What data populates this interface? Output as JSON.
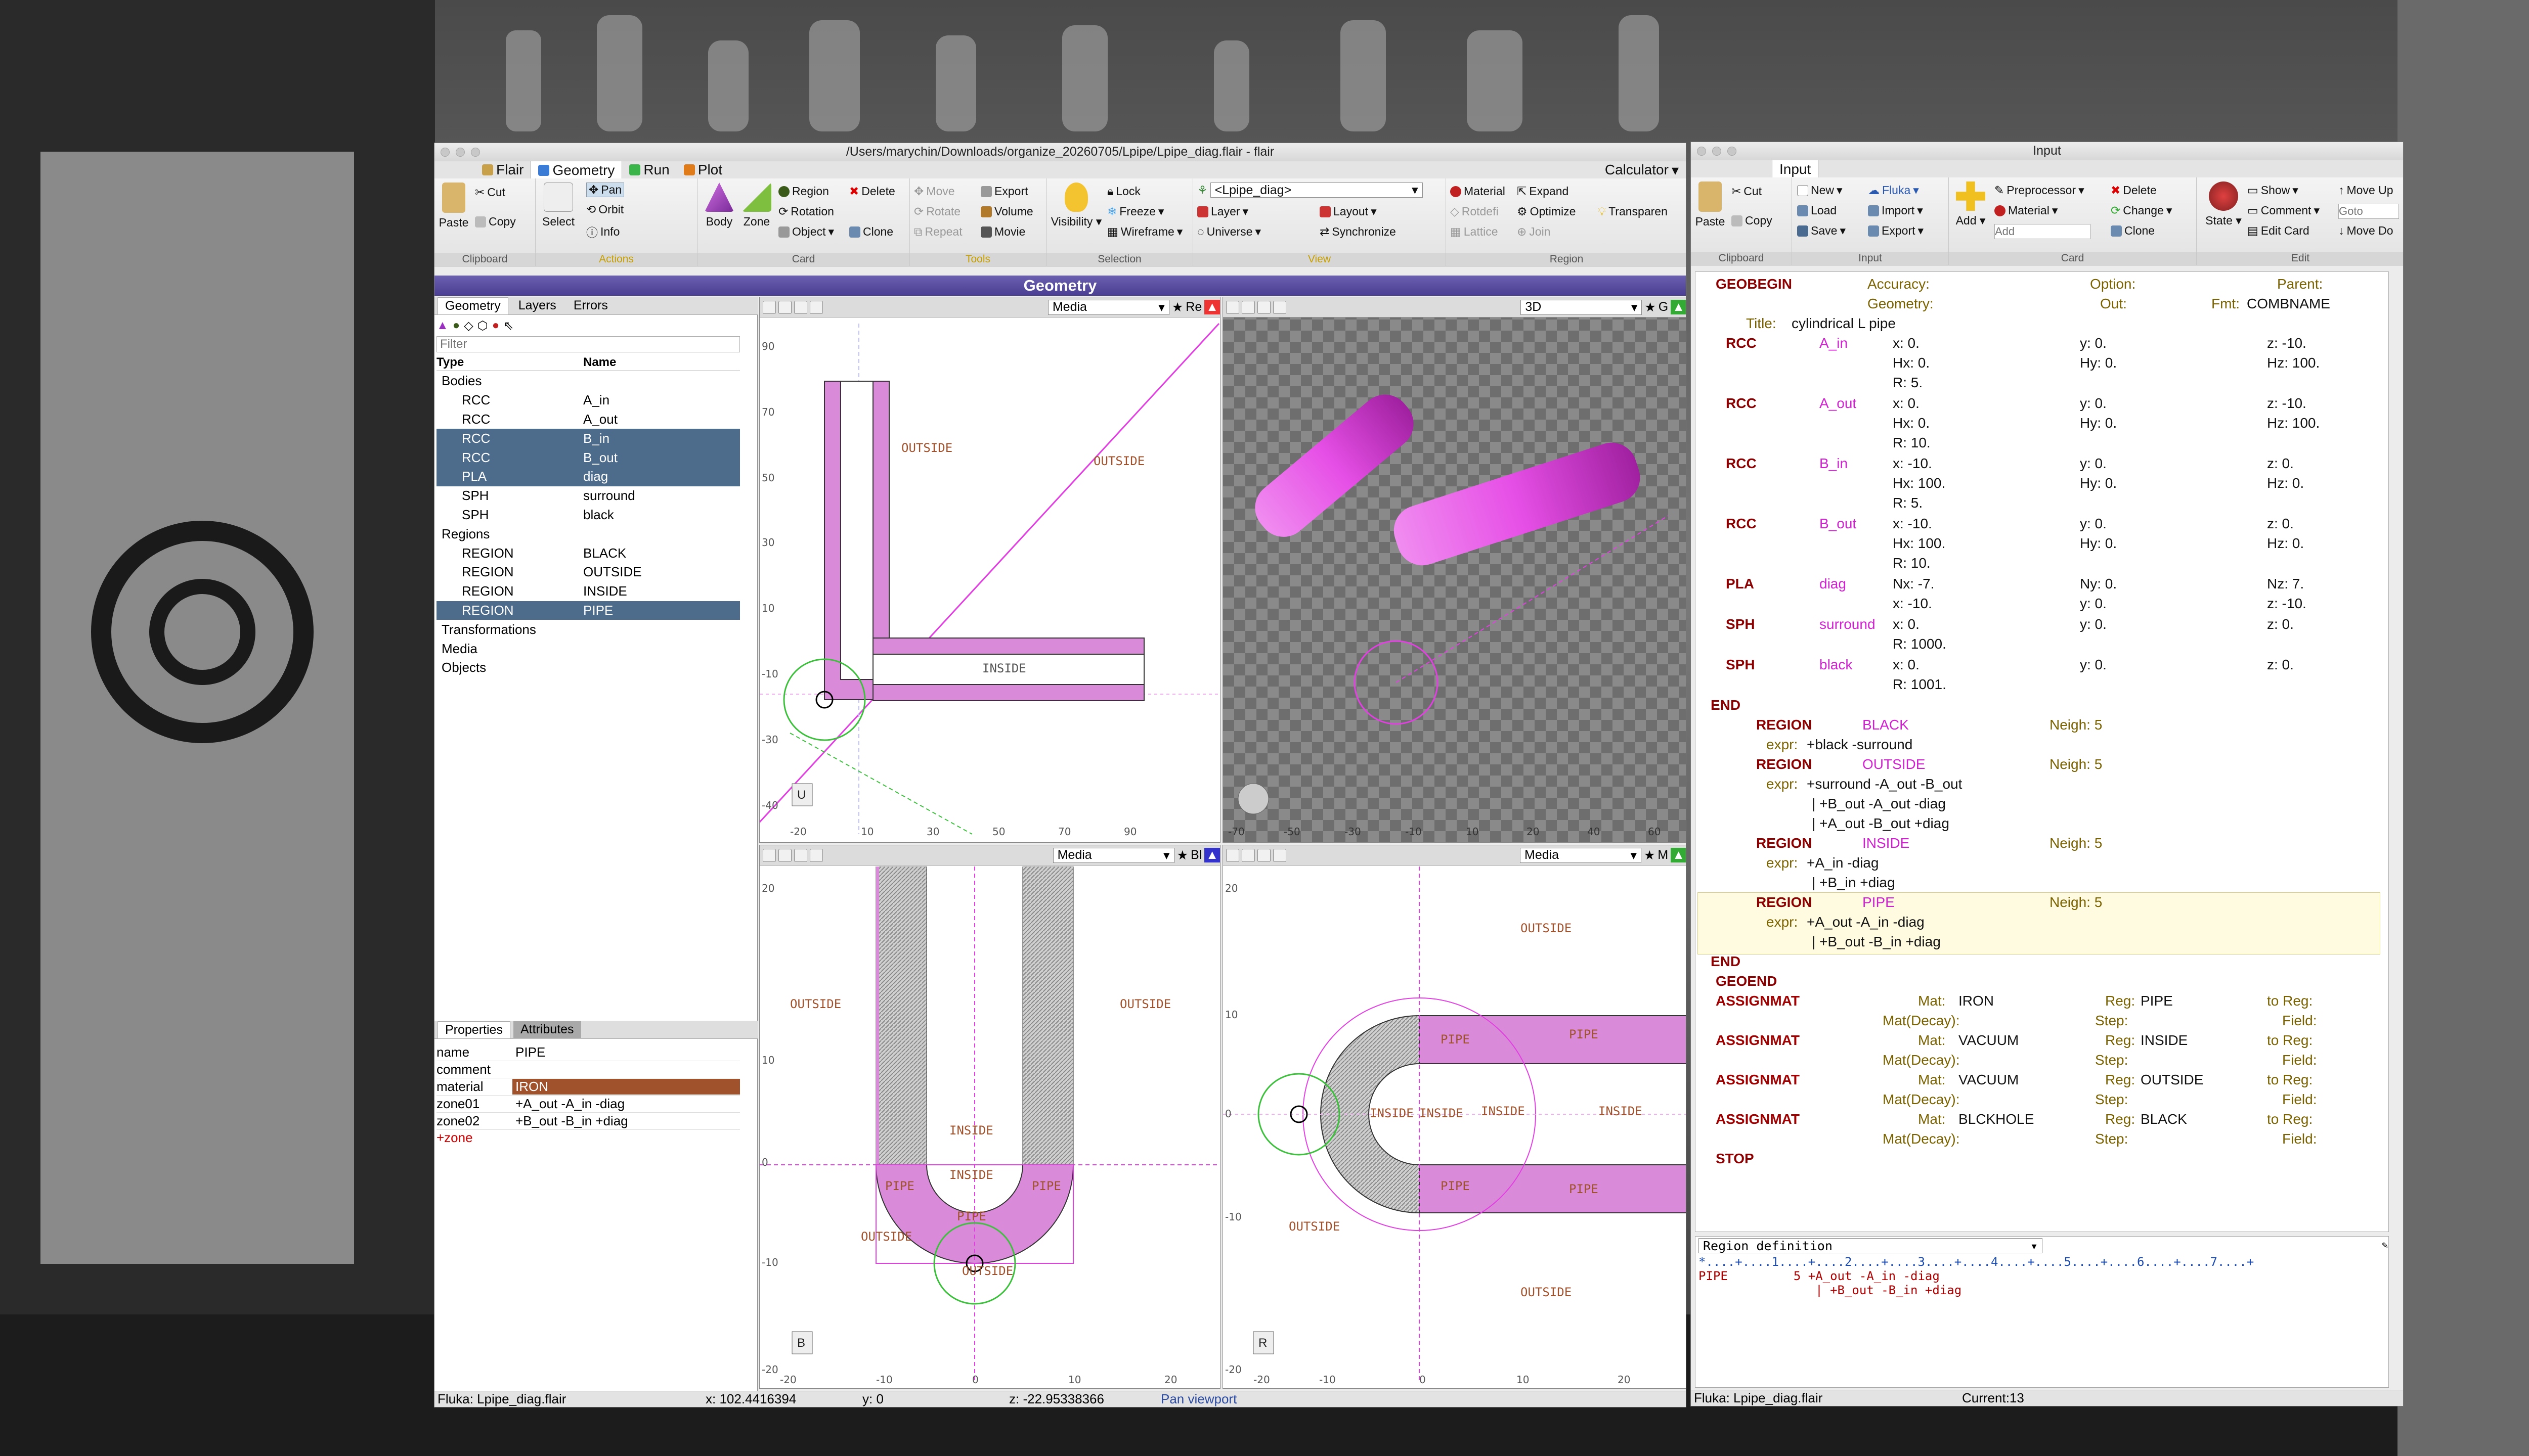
{
  "main_window": {
    "title": "/Users/marychin/Downloads/organize_20260705/Lpipe/Lpipe_diag.flair - flair",
    "tabs": [
      "Flair",
      "Geometry",
      "Run",
      "Plot"
    ],
    "calculator_label": "Calculator",
    "ribbon": {
      "clipboard": {
        "label": "Clipboard",
        "paste": "Paste",
        "cut": "Cut",
        "copy": "Copy"
      },
      "actions": {
        "label": "Actions",
        "select": "Select",
        "pan": "Pan",
        "orbit": "Orbit",
        "info": "Info"
      },
      "card": {
        "label": "Card",
        "body": "Body",
        "zone": "Zone",
        "region": "Region",
        "rotation": "Rotation",
        "object": "Object",
        "delete": "Delete",
        "clone": "Clone"
      },
      "tools": {
        "label": "Tools",
        "move": "Move",
        "rotate": "Rotate",
        "repeat": "Repeat",
        "export": "Export",
        "volume": "Volume",
        "movie": "Movie",
        "visibility": "Visibility"
      },
      "selection": {
        "label": "Selection",
        "lock": "Lock",
        "freeze": "Freeze",
        "wireframe": "Wireframe"
      },
      "view": {
        "label": "View",
        "combo": "<Lpipe_diag>",
        "layer": "Layer",
        "layout": "Layout",
        "universe": "Universe",
        "synchronize": "Synchronize"
      },
      "region": {
        "label": "Region",
        "material": "Material",
        "expand": "Expand",
        "rotdefi": "Rotdefi",
        "optimize": "Optimize",
        "transparent": "Transparen",
        "lattice": "Lattice",
        "join": "Join"
      }
    },
    "geometry_bar": "Geometry",
    "left_tabs": [
      "Geometry",
      "Layers",
      "Errors"
    ],
    "filter_placeholder": "Filter",
    "tree_headers": {
      "type": "Type",
      "name": "Name"
    },
    "tree": [
      {
        "type": "Bodies",
        "name": "",
        "level": 0,
        "group": true
      },
      {
        "type": "RCC",
        "name": "A_in",
        "level": 1
      },
      {
        "type": "RCC",
        "name": "A_out",
        "level": 1
      },
      {
        "type": "RCC",
        "name": "B_in",
        "level": 1,
        "selected": true
      },
      {
        "type": "RCC",
        "name": "B_out",
        "level": 1,
        "selected": true
      },
      {
        "type": "PLA",
        "name": "diag",
        "level": 1,
        "selected": true
      },
      {
        "type": "SPH",
        "name": "surround",
        "level": 1
      },
      {
        "type": "SPH",
        "name": "black",
        "level": 1
      },
      {
        "type": "Regions",
        "name": "",
        "level": 0,
        "group": true
      },
      {
        "type": "REGION",
        "name": "BLACK",
        "level": 1
      },
      {
        "type": "REGION",
        "name": "OUTSIDE",
        "level": 1
      },
      {
        "type": "REGION",
        "name": "INSIDE",
        "level": 1
      },
      {
        "type": "REGION",
        "name": "PIPE",
        "level": 1,
        "selected": true
      },
      {
        "type": "Transformations",
        "name": "",
        "level": 0,
        "group": true
      },
      {
        "type": "Media",
        "name": "",
        "level": 0,
        "group": true
      },
      {
        "type": "Objects",
        "name": "",
        "level": 0,
        "group": true
      }
    ],
    "props_tabs": [
      "Properties",
      "Attributes"
    ],
    "properties": [
      {
        "k": "name",
        "v": "PIPE"
      },
      {
        "k": "comment",
        "v": ""
      },
      {
        "k": "material",
        "v": "IRON"
      },
      {
        "k": "zone01",
        "v": "+A_out -A_in -diag"
      },
      {
        "k": "zone02",
        "v": "+B_out -B_in +diag"
      }
    ],
    "add_zone": "+zone",
    "viewports": {
      "tl": {
        "mode": "Media",
        "label_extra": "Re",
        "axis_badge": "U"
      },
      "tr": {
        "mode": "3D",
        "label_extra": "G"
      },
      "bl": {
        "mode": "Media",
        "label_extra": "Bl",
        "axis_badge": "B"
      },
      "br": {
        "mode": "Media",
        "label_extra": "M",
        "axis_badge": "R"
      }
    },
    "region_labels": {
      "outside": "OUTSIDE",
      "inside": "INSIDE",
      "pipe": "PIPE"
    },
    "status": {
      "file": "Fluka: Lpipe_diag.flair",
      "x": "x: 102.4416394",
      "y": "y: 0",
      "z": "z: -22.95338366",
      "mode": "Pan viewport"
    }
  },
  "input_window": {
    "title": "Input",
    "tab": "Input",
    "ribbon": {
      "clipboard": {
        "label": "Clipboard",
        "paste": "Paste",
        "cut": "Cut",
        "copy": "Copy"
      },
      "input": {
        "label": "Input",
        "new": "New",
        "fluka": "Fluka",
        "load": "Load",
        "import": "Import",
        "save": "Save",
        "export": "Export"
      },
      "card": {
        "label": "Card",
        "add": "Add",
        "preprocessor": "Preprocessor",
        "material": "Material",
        "add_placeholder": "Add",
        "delete": "Delete",
        "change": "Change",
        "clone": "Clone"
      },
      "edit": {
        "label": "Edit",
        "show": "Show",
        "comment": "Comment",
        "state": "State",
        "edit_card": "Edit Card",
        "move_up": "Move Up",
        "goto": "Goto",
        "move_down": "Move Do"
      }
    },
    "geobegin": {
      "title_label": "Title:",
      "title_value": "cylindrical L pipe",
      "fmt_label": "Fmt:",
      "fmt": "COMBNAME"
    },
    "bodies": [
      {
        "type": "RCC",
        "name": "A_in",
        "rows": [
          [
            "x: 0.",
            "y: 0.",
            "z: -10."
          ],
          [
            "Hx: 0.",
            "Hy: 0.",
            "Hz: 100."
          ],
          [
            "R: 5.",
            "",
            ""
          ]
        ]
      },
      {
        "type": "RCC",
        "name": "A_out",
        "rows": [
          [
            "x: 0.",
            "y: 0.",
            "z: -10."
          ],
          [
            "Hx: 0.",
            "Hy: 0.",
            "Hz: 100."
          ],
          [
            "R: 10.",
            "",
            ""
          ]
        ]
      },
      {
        "type": "RCC",
        "name": "B_in",
        "rows": [
          [
            "x: -10.",
            "y: 0.",
            "z: 0."
          ],
          [
            "Hx: 100.",
            "Hy: 0.",
            "Hz: 0."
          ],
          [
            "R: 5.",
            "",
            ""
          ]
        ]
      },
      {
        "type": "RCC",
        "name": "B_out",
        "rows": [
          [
            "x: -10.",
            "y: 0.",
            "z: 0."
          ],
          [
            "Hx: 100.",
            "Hy: 0.",
            "Hz: 0."
          ],
          [
            "R: 10.",
            "",
            ""
          ]
        ]
      },
      {
        "type": "PLA",
        "name": "diag",
        "rows": [
          [
            "Nx: -7.",
            "Ny: 0.",
            "Nz: 7."
          ],
          [
            "x: -10.",
            "y: 0.",
            "z: -10."
          ]
        ]
      },
      {
        "type": "SPH",
        "name": "surround",
        "rows": [
          [
            "x: 0.",
            "y: 0.",
            "z: 0."
          ],
          [
            "R: 1000.",
            "",
            ""
          ]
        ]
      },
      {
        "type": "SPH",
        "name": "black",
        "rows": [
          [
            "x: 0.",
            "y: 0.",
            "z: 0."
          ],
          [
            "R: 1001.",
            "",
            ""
          ]
        ]
      }
    ],
    "regions": [
      {
        "name": "BLACK",
        "neigh": "Neigh: 5",
        "expr": [
          "+black -surround"
        ]
      },
      {
        "name": "OUTSIDE",
        "neigh": "Neigh: 5",
        "expr": [
          "+surround -A_out -B_out",
          "| +B_out -A_out -diag",
          "| +A_out -B_out +diag"
        ]
      },
      {
        "name": "INSIDE",
        "neigh": "Neigh: 5",
        "expr": [
          "+A_in -diag",
          "| +B_in +diag"
        ]
      },
      {
        "name": "PIPE",
        "neigh": "Neigh: 5",
        "expr": [
          "+A_out -A_in -diag",
          "| +B_out -B_in +diag"
        ],
        "highlighted": true
      }
    ],
    "keywords": {
      "geobegin": "GEOBEGIN",
      "end": "END",
      "geoend": "GEOEND",
      "stop": "STOP",
      "region": "REGION",
      "expr": "expr:",
      "accuracy": "Accuracy:",
      "option": "Option:",
      "parent": "Parent:",
      "geometry": "Geometry:",
      "out": "Out:"
    },
    "assignmat": [
      {
        "mat": "IRON",
        "reg": "PIPE"
      },
      {
        "mat": "VACUUM",
        "reg": "INSIDE"
      },
      {
        "mat": "VACUUM",
        "reg": "OUTSIDE"
      },
      {
        "mat": "BLCKHOLE",
        "reg": "BLACK"
      }
    ],
    "assign_labels": {
      "kw": "ASSIGNMAT",
      "mat": "Mat:",
      "matdecay": "Mat(Decay):",
      "reg": "Reg:",
      "step": "Step:",
      "toreg": "to Reg:",
      "field": "Field:"
    },
    "editor": {
      "combo": "Region definition",
      "ruler": "*....+....1....+....2....+....3....+....4....+....5....+....6....+....7....+",
      "line1": "PIPE         5 +A_out -A_in -diag",
      "line2": "                | +B_out -B_in +diag"
    },
    "status": {
      "file": "Fluka: Lpipe_diag.flair",
      "current": "Current:13"
    }
  },
  "colors": {
    "pipe": "#d98ad9",
    "magenta": "#e000e0",
    "region_label": "#a0522d",
    "accent_purple": "#5447a0",
    "selection": "#4d6b8a"
  }
}
